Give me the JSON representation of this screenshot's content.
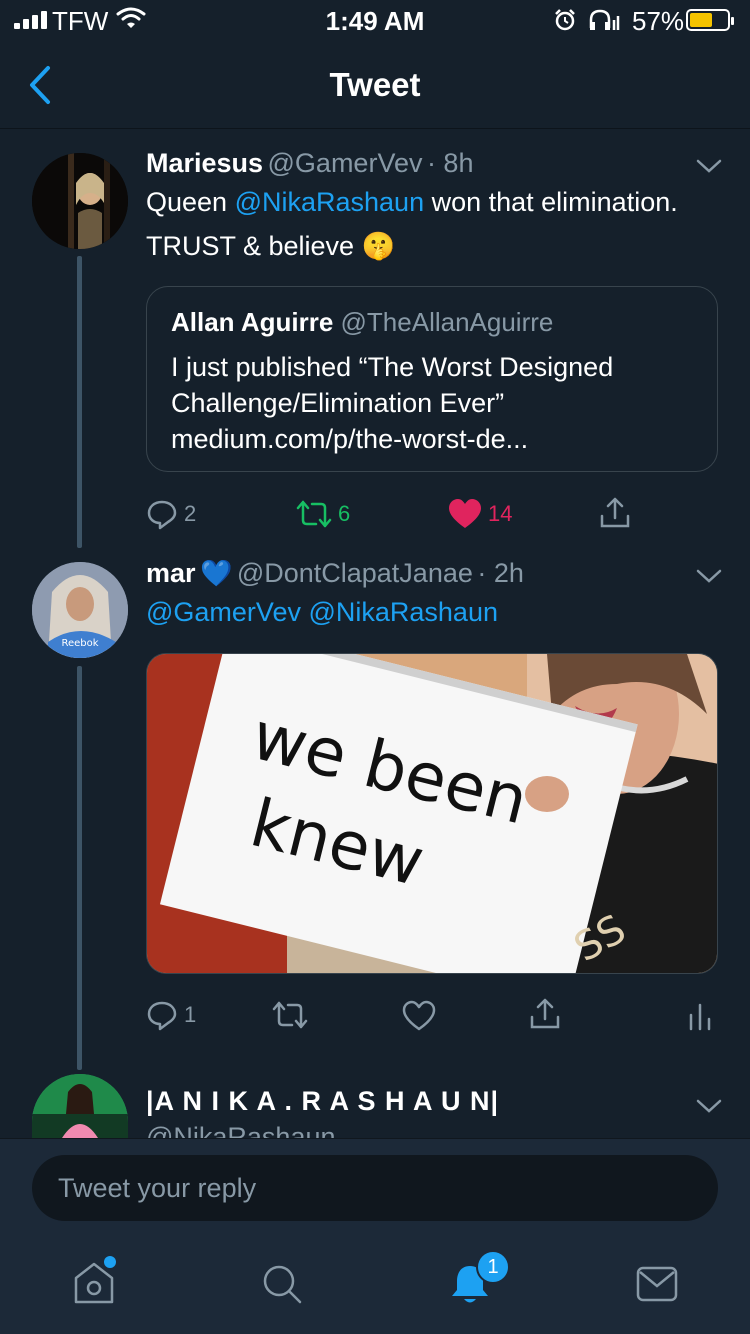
{
  "status_bar": {
    "carrier": "TFW",
    "time": "1:49 AM",
    "battery": "57%",
    "battery_level": 0.57
  },
  "nav": {
    "title": "Tweet"
  },
  "tweet1": {
    "name": "Mariesus",
    "handle": "@GamerVev",
    "time": "· 8h",
    "text_pre": "Queen ",
    "mention": "@NikaRashaun",
    "text_post": " won that elimination.",
    "line2": "TRUST & believe ",
    "emoji": "🤫",
    "quote": {
      "name": "Allan Aguirre",
      "handle": "@TheAllanAguirre",
      "line1": "I just published “The Worst Designed",
      "line2": "Challenge/Elimination Ever”",
      "line3": "medium.com/p/the-worst-de..."
    },
    "actions": {
      "replies": "2",
      "retweets": "6",
      "likes": "14"
    }
  },
  "tweet2": {
    "name": "mar",
    "emoji": "💙",
    "handle": "@DontClapatJanae",
    "time": "· 2h",
    "mention1": "@GamerVev",
    "mention2": "@NikaRashaun",
    "image_sign": {
      "line1": "we been",
      "line2": "knew"
    },
    "actions": {
      "replies": "1"
    }
  },
  "tweet3": {
    "name": "|A N I K A . R A S H A U N|",
    "handle": "@NikaRashaun"
  },
  "reply": {
    "placeholder": "Tweet your reply"
  },
  "tabs": {
    "notifications_badge": "1"
  },
  "colors": {
    "background": "#15202b",
    "accent": "#1da1f2",
    "retweet": "#17bf63",
    "like": "#e0245e",
    "secondary": "#8899a6"
  }
}
